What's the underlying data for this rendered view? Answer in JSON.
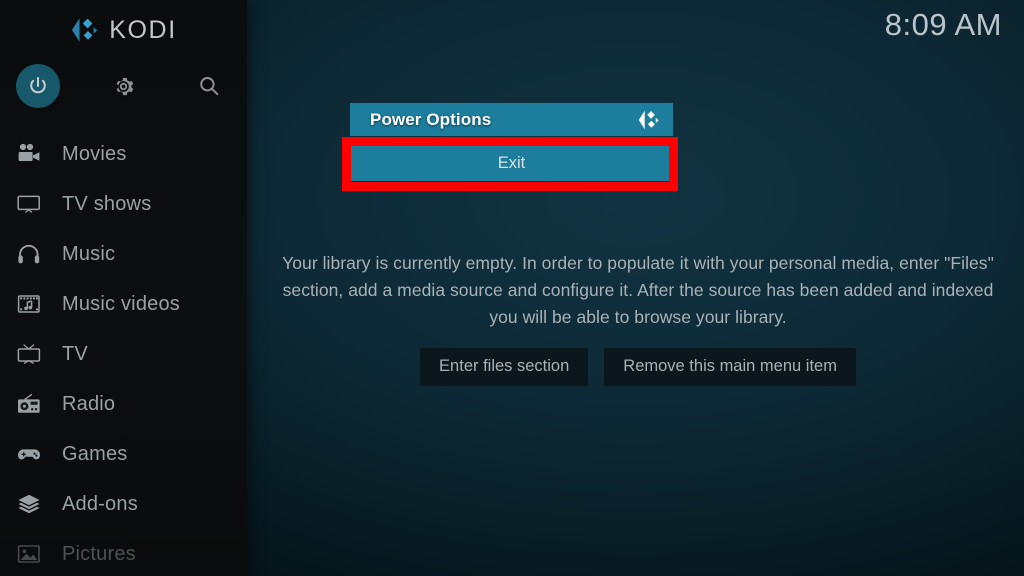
{
  "app": {
    "brand_name": "KODI",
    "brand_logo_icon": "kodi-logo-icon",
    "clock": "8:09 AM",
    "accent_color": "#1c7d9c",
    "annotation_color": "#fe0000",
    "background_color": "#0d2935",
    "sidebar_color": "#0a0c0d"
  },
  "sidebar": {
    "top_icons": [
      {
        "name": "power-icon",
        "glyph": "power",
        "label": "Power"
      },
      {
        "name": "gear-icon",
        "glyph": "gear",
        "label": "Settings"
      },
      {
        "name": "search-icon",
        "glyph": "search",
        "label": "Search"
      }
    ],
    "items": [
      {
        "label": "Movies",
        "icon": "movie-camera-icon",
        "dim": false
      },
      {
        "label": "TV shows",
        "icon": "television-icon",
        "dim": false
      },
      {
        "label": "Music",
        "icon": "headphones-icon",
        "dim": false
      },
      {
        "label": "Music videos",
        "icon": "film-music-icon",
        "dim": false
      },
      {
        "label": "TV",
        "icon": "crt-tv-icon",
        "dim": false
      },
      {
        "label": "Radio",
        "icon": "radio-icon",
        "dim": false
      },
      {
        "label": "Games",
        "icon": "gamepad-icon",
        "dim": false
      },
      {
        "label": "Add-ons",
        "icon": "addons-box-icon",
        "dim": false
      },
      {
        "label": "Pictures",
        "icon": "picture-icon",
        "dim": true
      }
    ]
  },
  "main": {
    "notice_text": "Your library is currently empty. In order to populate it with your personal media, enter \"Files\" section, add a media source and configure it. After the source has been added and indexed you will be able to browse your library.",
    "buttons": [
      {
        "label": "Enter files section"
      },
      {
        "label": "Remove this main menu item"
      }
    ]
  },
  "dialog": {
    "title": "Power Options",
    "logo_icon": "kodi-logo-icon",
    "options": [
      {
        "label": "Exit",
        "selected": true,
        "highlighted": true
      }
    ]
  }
}
